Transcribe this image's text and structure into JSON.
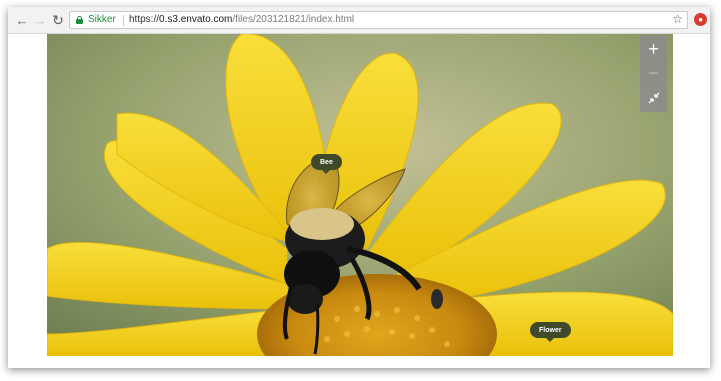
{
  "browser": {
    "nav": {
      "back_icon": "arrow-left-icon",
      "forward_icon": "arrow-right-icon",
      "reload_icon": "reload-icon"
    },
    "address_bar": {
      "secure_label": "Sikker",
      "url_scheme": "https://",
      "url_host": "0.s3.envato.com",
      "url_path": "/files/203121821/index.html",
      "bookmark_icon": "star-icon"
    },
    "extension_icon": "extension-icon"
  },
  "viewer": {
    "zoom_controls": {
      "zoom_in_icon": "plus-icon",
      "zoom_out_icon": "minus-icon",
      "reset_icon": "collapse-icon"
    },
    "tags": [
      {
        "label": "Bee"
      },
      {
        "label": "Flower"
      }
    ]
  },
  "colors": {
    "secure_green": "#1e8e3e",
    "tag_background": "#3f4a2b",
    "petal_yellow": "#f5d21b",
    "zoom_panel": "#8c8c8c"
  }
}
